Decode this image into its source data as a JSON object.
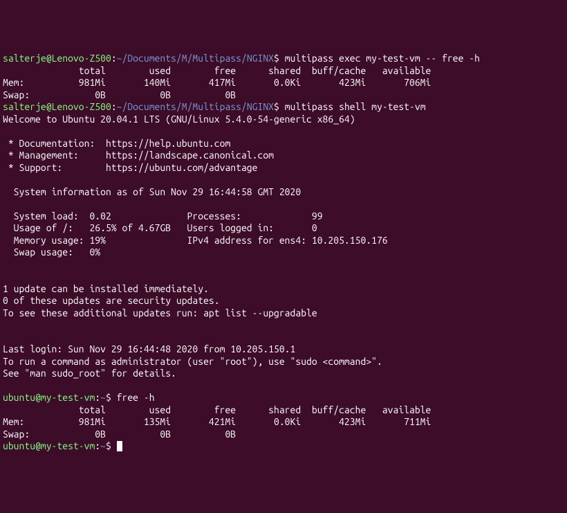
{
  "line1_prompt_user": "salterje@Lenovo-Z500",
  "line1_prompt_colon": ":",
  "line1_prompt_path": "~/Documents/M/Multipass/NGINX",
  "line1_prompt_dollar": "$ ",
  "line1_command": "multipass exec my-test-vm -- free -h",
  "free1_header": "              total        used        free      shared  buff/cache   available",
  "free1_mem": "Mem:          981Mi       140Mi       417Mi       0.0Ki       423Mi       706Mi",
  "free1_swap": "Swap:            0B          0B          0B",
  "line2_prompt_user": "salterje@Lenovo-Z500",
  "line2_prompt_colon": ":",
  "line2_prompt_path": "~/Documents/M/Multipass/NGINX",
  "line2_prompt_dollar": "$ ",
  "line2_command": "multipass shell my-test-vm",
  "welcome": "Welcome to Ubuntu 20.04.1 LTS (GNU/Linux 5.4.0-54-generic x86_64)",
  "blank": "",
  "doc_line": " * Documentation:  https://help.ubuntu.com",
  "mgmt_line": " * Management:     https://landscape.canonical.com",
  "support_line": " * Support:        https://ubuntu.com/advantage",
  "sysinfo_header": "  System information as of Sun Nov 29 16:44:58 GMT 2020",
  "sysinfo_l1": "  System load:  0.02              Processes:             99",
  "sysinfo_l2": "  Usage of /:   26.5% of 4.67GB   Users logged in:       0",
  "sysinfo_l3": "  Memory usage: 19%               IPv4 address for ens4: 10.205.150.176",
  "sysinfo_l4": "  Swap usage:   0%",
  "update_l1": "1 update can be installed immediately.",
  "update_l2": "0 of these updates are security updates.",
  "update_l3": "To see these additional updates run: apt list --upgradable",
  "lastlogin": "Last login: Sun Nov 29 16:44:48 2020 from 10.205.150.1",
  "sudo_l1": "To run a command as administrator (user \"root\"), use \"sudo <command>\".",
  "sudo_l2": "See \"man sudo_root\" for details.",
  "vm_prompt_user": "ubuntu@my-test-vm",
  "vm_prompt_colon": ":",
  "vm_prompt_path": "~",
  "vm_prompt_dollar": "$ ",
  "vm_command1": "free -h",
  "free2_header": "              total        used        free      shared  buff/cache   available",
  "free2_mem": "Mem:          981Mi       135Mi       421Mi       0.0Ki       423Mi       711Mi",
  "free2_swap": "Swap:            0B          0B          0B"
}
